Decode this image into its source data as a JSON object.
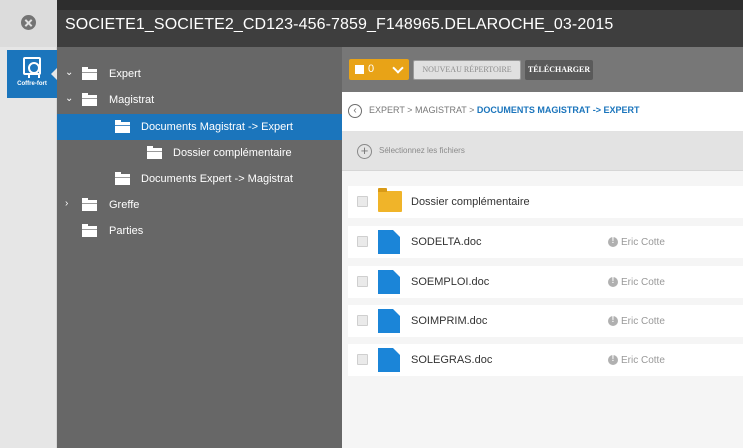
{
  "window": {
    "title": "SOCIETE1_SOCIETE2_CD123-456-7859_F148965.DELAROCHE_03-2015"
  },
  "rail": {
    "vault_label": "Coffre-fort"
  },
  "tree": {
    "items": [
      {
        "label": "Expert",
        "expanded": false
      },
      {
        "label": "Magistrat",
        "expanded": true
      },
      {
        "label": "Documents Magistrat -> Expert",
        "selected": true
      },
      {
        "label": "Dossier complémentaire"
      },
      {
        "label": "Documents Expert -> Magistrat"
      },
      {
        "label": "Greffe",
        "expanded": false
      },
      {
        "label": "Parties"
      }
    ]
  },
  "toolbar": {
    "selected_count": "0",
    "new_folder_label": "NOUVEAU RÉPERTOIRE",
    "download_label": "TÉLÉCHARGER",
    "accent_color": "#e8a317"
  },
  "breadcrumb": {
    "path": "EXPERT > MAGISTRAT > ",
    "current": "DOCUMENTS MAGISTRAT -> EXPERT"
  },
  "upload": {
    "label": "Sélectionnez les fichiers"
  },
  "files": [
    {
      "name": "Dossier complémentaire",
      "type": "folder",
      "owner": ""
    },
    {
      "name": "SODELTA.doc",
      "type": "doc",
      "owner": "Eric Cotte"
    },
    {
      "name": "SOEMPLOI.doc",
      "type": "doc",
      "owner": "Eric Cotte"
    },
    {
      "name": "SOIMPRIM.doc",
      "type": "doc",
      "owner": "Eric Cotte"
    },
    {
      "name": "SOLEGRAS.doc",
      "type": "doc",
      "owner": "Eric Cotte"
    }
  ],
  "colors": {
    "brand_blue": "#1b75bc",
    "title_bar": "#3e3e3e",
    "tree_bg": "#676767"
  }
}
